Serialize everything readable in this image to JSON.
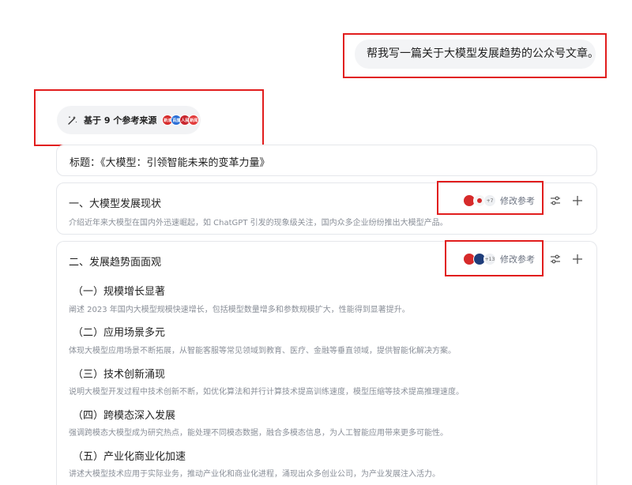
{
  "user_message": "帮我写一篇关于大模型发展趋势的公众号文章。",
  "sources": {
    "label": "基于 9 个参考来源",
    "icons": [
      {
        "name": "source-favicon-1",
        "color": "#d62a2a",
        "text": "新浪"
      },
      {
        "name": "source-favicon-2",
        "color": "#2b6fd6",
        "text": "百度"
      },
      {
        "name": "source-favicon-3",
        "color": "#c8262e",
        "text": "人民"
      },
      {
        "name": "source-favicon-4",
        "color": "#e23b3b",
        "text": "新闻"
      }
    ]
  },
  "article": {
    "title": "标题：《大模型：引领智能未来的变革力量》",
    "modify_label": "修改参考",
    "sections": [
      {
        "heading": "一、大模型发展现状",
        "desc": "介绍近年来大模型在国内外迅速崛起，如 ChatGPT 引发的现象级关注，国内众多企业纷纷推出大模型产品。",
        "ref_more": "+7"
      },
      {
        "heading": "二、发展趋势面面观",
        "ref_more": "+13",
        "subsections": [
          {
            "heading": "（一）规模增长显著",
            "desc": "阐述 2023 年国内大模型规模快速增长，包括模型数量增多和参数规模扩大，性能得到显著提升。"
          },
          {
            "heading": "（二）应用场景多元",
            "desc": "体现大模型应用场景不断拓展，从智能客服等常见领域到教育、医疗、金融等垂直领域，提供智能化解决方案。"
          },
          {
            "heading": "（三）技术创新涌现",
            "desc": "说明大模型开发过程中技术创新不断，如优化算法和并行计算技术提高训练速度，模型压缩等技术提高推理速度。"
          },
          {
            "heading": "（四）跨模态深入发展",
            "desc": "强调跨模态大模型成为研究热点，能处理不同模态数据，融合多模态信息，为人工智能应用带来更多可能性。"
          },
          {
            "heading": "（五）产业化商业化加速",
            "desc": "讲述大模型技术应用于实际业务，推动产业化和商业化进程，涌现出众多创业公司，为产业发展注入活力。"
          }
        ]
      }
    ]
  },
  "colors": {
    "highlight_box": "#e11d1d",
    "muted_text": "#8a8f98",
    "pill_bg": "#f2f3f5"
  }
}
